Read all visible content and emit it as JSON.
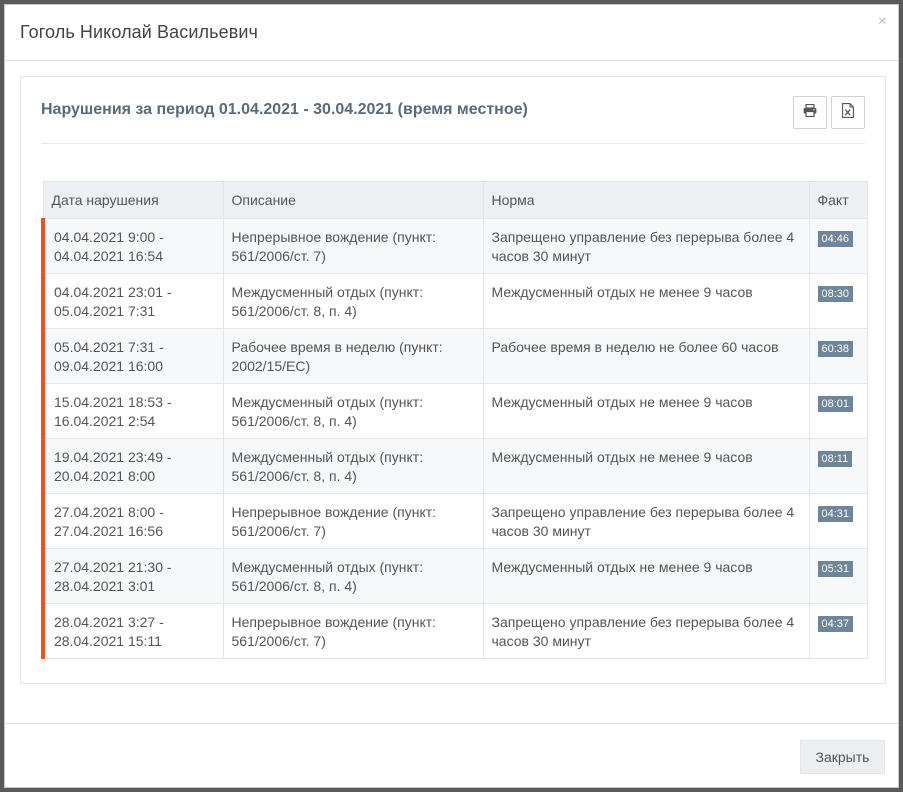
{
  "dialog": {
    "title": "Гоголь Николай Васильевич",
    "close_icon": "×"
  },
  "panel": {
    "title": "Нарушения за период 01.04.2021 - 30.04.2021 (время местное)",
    "tools": [
      "print-icon",
      "excel-icon"
    ]
  },
  "table": {
    "headers": [
      "Дата нарушения",
      "Описание",
      "Норма",
      "Факт"
    ],
    "rows": [
      {
        "date": "04.04.2021 9:00 - 04.04.2021 16:54",
        "desc": "Непрерывное вождение (пункт: 561/2006/ст. 7)",
        "norm": "Запрещено управление без перерыва более 4 часов 30 минут",
        "fact": "04:46"
      },
      {
        "date": "04.04.2021 23:01 - 05.04.2021 7:31",
        "desc": "Междусменный отдых (пункт: 561/2006/ст. 8, п. 4)",
        "norm": "Междусменный отдых не менее 9 часов",
        "fact": "08:30"
      },
      {
        "date": "05.04.2021 7:31 - 09.04.2021 16:00",
        "desc": "Рабочее время в неделю (пункт: 2002/15/EC)",
        "norm": "Рабочее время в неделю не более 60 часов",
        "fact": "60:38"
      },
      {
        "date": "15.04.2021 18:53 - 16.04.2021 2:54",
        "desc": "Междусменный отдых (пункт: 561/2006/ст. 8, п. 4)",
        "norm": "Междусменный отдых не менее 9 часов",
        "fact": "08:01"
      },
      {
        "date": "19.04.2021 23:49 - 20.04.2021 8:00",
        "desc": "Междусменный отдых (пункт: 561/2006/ст. 8, п. 4)",
        "norm": "Междусменный отдых не менее 9 часов",
        "fact": "08:11"
      },
      {
        "date": "27.04.2021 8:00 - 27.04.2021 16:56",
        "desc": "Непрерывное вождение (пункт: 561/2006/ст. 7)",
        "norm": "Запрещено управление без перерыва более 4 часов 30 минут",
        "fact": "04:31"
      },
      {
        "date": "27.04.2021 21:30 - 28.04.2021 3:01",
        "desc": "Междусменный отдых (пункт: 561/2006/ст. 8, п. 4)",
        "norm": "Междусменный отдых не менее 9 часов",
        "fact": "05:31"
      },
      {
        "date": "28.04.2021 3:27 - 28.04.2021 15:11",
        "desc": "Непрерывное вождение (пункт: 561/2006/ст. 7)",
        "norm": "Запрещено управление без перерыва более 4 часов 30 минут",
        "fact": "04:37"
      }
    ]
  },
  "footer": {
    "close_label": "Закрыть"
  },
  "colors": {
    "violation_marker": "#e9541c",
    "fact_badge": "#6f859b",
    "panel_title": "#5a6a7c"
  }
}
